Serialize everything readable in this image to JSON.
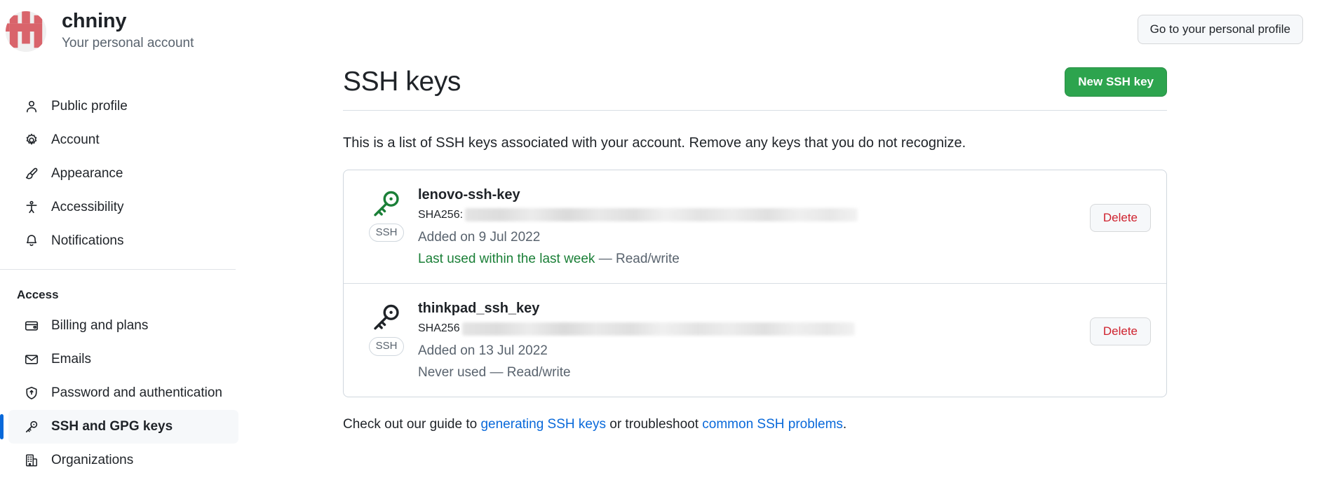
{
  "account": {
    "name": "chniny",
    "subtitle": "Your personal account",
    "avatar_icon": "identicon-avatar",
    "avatar_color": "#d9646b"
  },
  "header": {
    "profile_button": "Go to your personal profile"
  },
  "sidebar": {
    "personal_items": [
      {
        "label": "Public profile",
        "icon": "person-icon",
        "active": false
      },
      {
        "label": "Account",
        "icon": "gear-icon",
        "active": false
      },
      {
        "label": "Appearance",
        "icon": "paintbrush-icon",
        "active": false
      },
      {
        "label": "Accessibility",
        "icon": "accessibility-icon",
        "active": false
      },
      {
        "label": "Notifications",
        "icon": "bell-icon",
        "active": false
      }
    ],
    "section_title": "Access",
    "access_items": [
      {
        "label": "Billing and plans",
        "icon": "credit-card-icon",
        "active": false
      },
      {
        "label": "Emails",
        "icon": "mail-icon",
        "active": false
      },
      {
        "label": "Password and authentication",
        "icon": "shield-lock-icon",
        "active": false
      },
      {
        "label": "SSH and GPG keys",
        "icon": "key-icon",
        "active": true
      },
      {
        "label": "Organizations",
        "icon": "organization-icon",
        "active": false
      }
    ],
    "active_accent": "#0969da"
  },
  "main": {
    "title": "SSH keys",
    "new_key_button": "New SSH key",
    "new_key_button_color": "#2da44e",
    "description": "This is a list of SSH keys associated with your account. Remove any keys that you do not recognize.",
    "keys": [
      {
        "name": "lenovo-ssh-key",
        "fingerprint_label": "SHA256:",
        "fingerprint_value": "",
        "added": "Added on 9 Jul 2022",
        "last_used": "Last used within the last week",
        "permission": " — Read/write",
        "badge": "SSH",
        "key_icon": "key-icon",
        "key_icon_color": "#1a7f37",
        "status_color": "#1a7f37",
        "delete_label": "Delete"
      },
      {
        "name": "thinkpad_ssh_key",
        "fingerprint_label": "SHA256",
        "fingerprint_value": "",
        "added": "Added on 13 Jul 2022",
        "last_used": "Never used",
        "permission": " — Read/write",
        "badge": "SSH",
        "key_icon": "key-icon",
        "key_icon_color": "#1f2328",
        "status_color": "#59636e",
        "delete_label": "Delete"
      }
    ],
    "footer": {
      "text_start": "Check out our guide to ",
      "link1": "generating SSH keys",
      "text_mid": " or troubleshoot ",
      "link2": "common SSH problems",
      "text_end": ".",
      "link_color": "#0969da"
    }
  }
}
